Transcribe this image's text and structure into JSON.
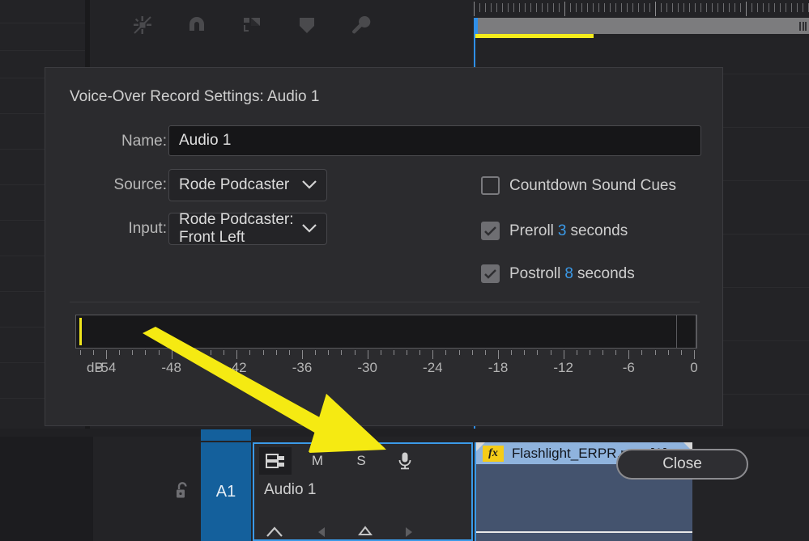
{
  "app": {
    "toolbar_icons": [
      {
        "name": "linked-selection-icon",
        "label": "Linked Selection"
      },
      {
        "name": "snap-magnet-icon",
        "label": "Snap"
      },
      {
        "name": "marker-flag-icon",
        "label": "Add Marker Flag"
      },
      {
        "name": "marker-shield-icon",
        "label": "Marker"
      },
      {
        "name": "wrench-settings-icon",
        "label": "Timeline Display Settings"
      }
    ],
    "ruler": {
      "render_bar_color": "#f4ec1c",
      "playhead_color": "#2f8fe8"
    }
  },
  "dialog": {
    "title": "Voice-Over Record Settings: Audio 1",
    "fields": {
      "name_label": "Name:",
      "name_value": "Audio 1",
      "name_placeholder": "Audio 1",
      "source_label": "Source:",
      "source_value": "Rode Podcaster",
      "input_label": "Input:",
      "input_value": "Rode Podcaster:  Front Left"
    },
    "checkboxes": [
      {
        "name": "countdown-sound-cues",
        "label": "Countdown Sound Cues",
        "checked": false,
        "number": "",
        "suffix": ""
      },
      {
        "name": "preroll",
        "label": "Preroll",
        "checked": true,
        "number": "3",
        "suffix": "seconds"
      },
      {
        "name": "postroll",
        "label": "Postroll",
        "checked": true,
        "number": "8",
        "suffix": "seconds"
      }
    ],
    "meter": {
      "unit_label": "dB",
      "ticks": [
        "-54",
        "-48",
        "-42",
        "-36",
        "-30",
        "-24",
        "-18",
        "-12",
        "-6",
        "0"
      ],
      "level_color": "#efe51c"
    },
    "close_label": "Close",
    "accent_color": "#3b9ae8"
  },
  "timeline": {
    "track": {
      "name_label": "A1",
      "track_title": "Audio 1",
      "lock_icon": "lock-open-icon",
      "target_icon": "track-target-icon",
      "mute_label": "M",
      "solo_label": "S",
      "mic_icon": "microphone-icon",
      "selected_color": "#3b9ae8",
      "button_color": "#14609c"
    },
    "clip": {
      "title": "Flashlight_ERPR.mov [A]",
      "fx_badge": "fx",
      "header_color": "#8fb3dd",
      "body_color": "#44536e"
    }
  },
  "annotation": {
    "arrow_color": "#f5ea12",
    "name": "yellow-pointer-arrow"
  }
}
